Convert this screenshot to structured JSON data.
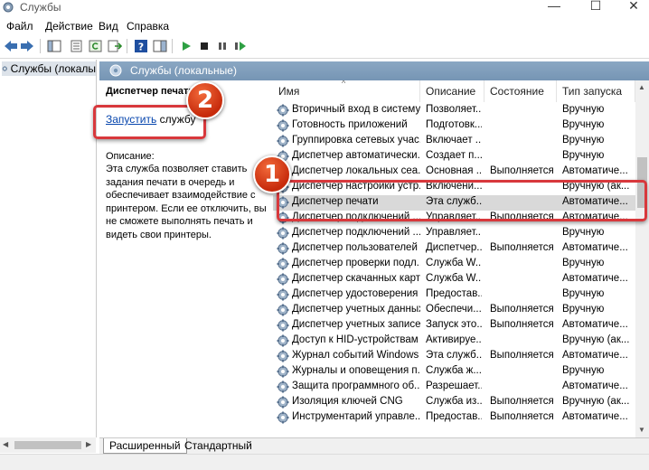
{
  "window": {
    "title": "Службы"
  },
  "menu": [
    "Файл",
    "Действие",
    "Вид",
    "Справка"
  ],
  "tree": {
    "item": "Службы (локалы"
  },
  "pane": {
    "header": "Службы (локальные)"
  },
  "description": {
    "title": "Диспетчер печати",
    "start_link": "Запустить",
    "start_suffix": " службу",
    "label": "Описание:",
    "text": "Эта служба позволяет ставить задания печати в очередь и обеспечивает взаимодействие с принтером. Если ее отключить, вы не сможете выполнять печать и видеть свои принтеры."
  },
  "columns": {
    "name": "Имя",
    "desc": "Описание",
    "state": "Состояние",
    "start": "Тип запуска"
  },
  "rows": [
    {
      "name": "Вторичный вход в систему",
      "desc": "Позволяет...",
      "state": "",
      "start": "Вручную"
    },
    {
      "name": "Готовность приложений",
      "desc": "Подготовк...",
      "state": "",
      "start": "Вручную"
    },
    {
      "name": "Группировка сетевых учас...",
      "desc": "Включает ...",
      "state": "",
      "start": "Вручную"
    },
    {
      "name": "Диспетчер автоматически...",
      "desc": "Создает п...",
      "state": "",
      "start": "Вручную"
    },
    {
      "name": "Диспетчер локальных сеа...",
      "desc": "Основная ...",
      "state": "Выполняется",
      "start": "Автоматиче..."
    },
    {
      "name": "Диспетчер настройки устр...",
      "desc": "Включени...",
      "state": "",
      "start": "Вручную (ак..."
    },
    {
      "name": "Диспетчер печати",
      "desc": "Эта служб...",
      "state": "",
      "start": "Автоматиче..."
    },
    {
      "name": "Диспетчер подключений ...",
      "desc": "Управляет...",
      "state": "Выполняется",
      "start": "Автоматиче..."
    },
    {
      "name": "Диспетчер подключений ...",
      "desc": "Управляет...",
      "state": "",
      "start": "Вручную"
    },
    {
      "name": "Диспетчер пользователей",
      "desc": "Диспетчер...",
      "state": "Выполняется",
      "start": "Автоматиче..."
    },
    {
      "name": "Диспетчер проверки подл...",
      "desc": "Служба W...",
      "state": "",
      "start": "Вручную"
    },
    {
      "name": "Диспетчер скачанных карт",
      "desc": "Служба W...",
      "state": "",
      "start": "Автоматиче..."
    },
    {
      "name": "Диспетчер удостоверения ...",
      "desc": "Предостав...",
      "state": "",
      "start": "Вручную"
    },
    {
      "name": "Диспетчер учетных данных",
      "desc": "Обеспечи...",
      "state": "Выполняется",
      "start": "Вручную"
    },
    {
      "name": "Диспетчер учетных записе...",
      "desc": "Запуск это...",
      "state": "Выполняется",
      "start": "Автоматиче..."
    },
    {
      "name": "Доступ к HID-устройствам",
      "desc": "Активируе...",
      "state": "",
      "start": "Вручную (ак..."
    },
    {
      "name": "Журнал событий Windows",
      "desc": "Эта служб...",
      "state": "Выполняется",
      "start": "Автоматиче..."
    },
    {
      "name": "Журналы и оповещения п...",
      "desc": "Служба ж...",
      "state": "",
      "start": "Вручную"
    },
    {
      "name": "Защита программного об...",
      "desc": "Разрешает...",
      "state": "",
      "start": "Автоматиче..."
    },
    {
      "name": "Изоляция ключей CNG",
      "desc": "Служба из...",
      "state": "Выполняется",
      "start": "Вручную (ак..."
    },
    {
      "name": "Инструментарий управле...",
      "desc": "Предостав...",
      "state": "Выполняется",
      "start": "Автоматиче..."
    }
  ],
  "tabs": [
    "Расширенный",
    "Стандартный"
  ],
  "annotations": [
    "1",
    "2"
  ],
  "colors": {
    "annotation": "#d8383c",
    "header": "#7f9db9",
    "selected": "#d9d9d9",
    "link": "#0645ad"
  }
}
